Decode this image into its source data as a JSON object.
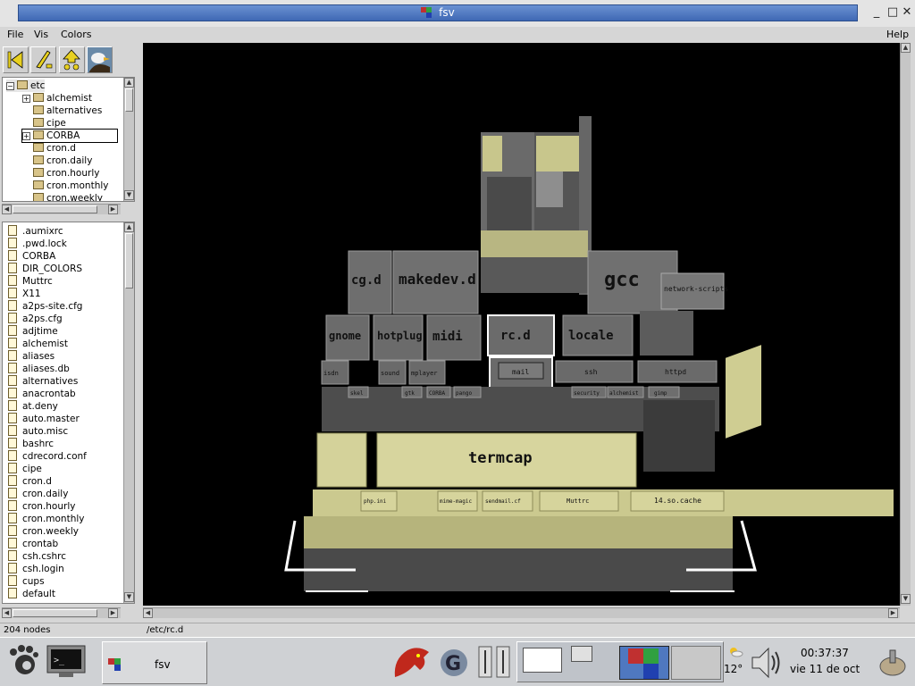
{
  "window": {
    "title": "fsv"
  },
  "menubar": {
    "items": [
      "File",
      "Vis",
      "Colors"
    ],
    "help": "Help"
  },
  "tree": {
    "items": [
      {
        "label": "etc",
        "level": 0,
        "expander": "⊟",
        "selected": true
      },
      {
        "label": "alchemist",
        "level": 1,
        "expander": "+"
      },
      {
        "label": "alternatives",
        "level": 1,
        "expander": ""
      },
      {
        "label": "cipe",
        "level": 1,
        "expander": ""
      },
      {
        "label": "CORBA",
        "level": 1,
        "expander": "+",
        "focused": true
      },
      {
        "label": "cron.d",
        "level": 1,
        "expander": ""
      },
      {
        "label": "cron.daily",
        "level": 1,
        "expander": ""
      },
      {
        "label": "cron.hourly",
        "level": 1,
        "expander": ""
      },
      {
        "label": "cron.monthly",
        "level": 1,
        "expander": ""
      },
      {
        "label": "cron.weekly",
        "level": 1,
        "expander": ""
      }
    ]
  },
  "files": {
    "items": [
      ".aumixrc",
      ".pwd.lock",
      "CORBA",
      "DIR_COLORS",
      "Muttrc",
      "X11",
      "a2ps-site.cfg",
      "a2ps.cfg",
      "adjtime",
      "alchemist",
      "aliases",
      "aliases.db",
      "alternatives",
      "anacrontab",
      "at.deny",
      "auto.master",
      "auto.misc",
      "bashrc",
      "cdrecord.conf",
      "cipe",
      "cron.d",
      "cron.daily",
      "cron.hourly",
      "cron.monthly",
      "cron.weekly",
      "crontab",
      "csh.cshrc",
      "csh.login",
      "cups",
      "default"
    ]
  },
  "status": {
    "nodes": "204 nodes",
    "path": "/etc/rc.d"
  },
  "viewer": {
    "labels_large": [
      "makedev.d",
      "termcap",
      "gcc"
    ],
    "labels_medium": [
      "cg.d",
      "gnome",
      "hotplug",
      "midi",
      "rc.d",
      "locale",
      "14.so.cache",
      "Muttrc",
      "sendmail.cf",
      "mime-magic",
      "php.ini"
    ],
    "labels_small": [
      "mail",
      "ssh",
      "httpd",
      "network-scripts",
      "CORBA",
      "pango",
      "security",
      "alchemist",
      "gimp",
      "isdn",
      "sound",
      "mplayer",
      "skel",
      "gtk"
    ]
  },
  "taskbar": {
    "task_label": "fsv",
    "weather": "12°",
    "clock_time": "00:37:37",
    "clock_date": "vie 11 de oct"
  },
  "colors": {
    "titlebar": "#4a73bd",
    "dir_gray": "#6e6e6e",
    "file_khaki": "#d4d29a",
    "highlight": "#ffffff"
  }
}
